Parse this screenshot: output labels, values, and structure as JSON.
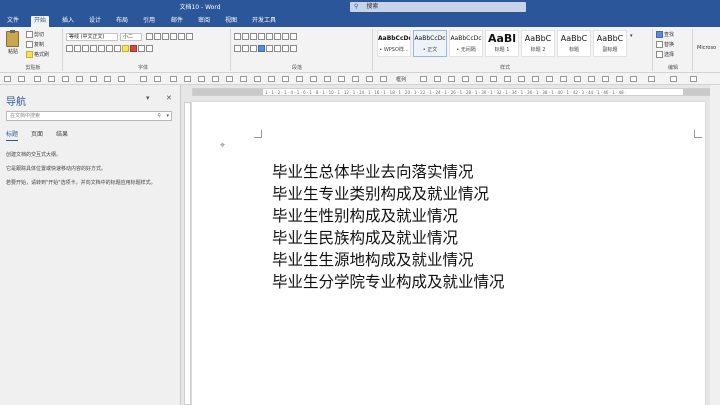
{
  "window": {
    "title": "文档10 - Word"
  },
  "search": {
    "placeholder": "搜索"
  },
  "tabs": [
    {
      "label": "文件"
    },
    {
      "label": "开始"
    },
    {
      "label": "插入"
    },
    {
      "label": "设计"
    },
    {
      "label": "布局"
    },
    {
      "label": "引用"
    },
    {
      "label": "邮件"
    },
    {
      "label": "审阅"
    },
    {
      "label": "视图"
    },
    {
      "label": "开发工具"
    }
  ],
  "ribbon": {
    "clipboard": {
      "paste": "粘贴",
      "cut": "剪切",
      "copy": "复制",
      "format_painter": "格式刷",
      "group": "剪贴板"
    },
    "font": {
      "name": "等线 (中文正文)",
      "size": "小二",
      "group": "字体"
    },
    "paragraph": {
      "group": "段落"
    },
    "styles": {
      "group": "样式",
      "items": [
        {
          "preview": "AaBbCcDd",
          "name": "• WPSO样..."
        },
        {
          "preview": "AaBbCcDc",
          "name": "• 正文"
        },
        {
          "preview": "AaBbCcDc",
          "name": "• 无间隔"
        },
        {
          "preview": "AaBl",
          "name": "标题 1"
        },
        {
          "preview": "AaBbC",
          "name": "标题 2"
        },
        {
          "preview": "AaBbC",
          "name": "标题"
        },
        {
          "preview": "AaBbC",
          "name": "副标题"
        }
      ]
    },
    "editing": {
      "find": "查找",
      "replace": "替换",
      "select": "选择",
      "group": "编辑"
    },
    "extra": "Microso"
  },
  "qat": {
    "rows_label": "框列"
  },
  "nav": {
    "title": "导航",
    "search_placeholder": "在文档中搜索",
    "tabs": [
      {
        "label": "标题"
      },
      {
        "label": "页面"
      },
      {
        "label": "结果"
      }
    ],
    "text1": "创建文档的交互式大纲。",
    "text2": "它是跟踪具体位置或快速移动内容的好方式。",
    "text3": "若要开始，请转到\"开始\"选项卡，并向文档中的标题应用标题样式。"
  },
  "ruler": {
    "ticks": "1 · 1 · 2 · 1 · 4 · 1 · 6 · 1 · 8 · 1 · 10 · 1 · 12 · 1 · 14 · 1 · 16 · 1 · 18 · 1 · 20 · 1 · 22 · 1 · 24 · 1 · 26 · 1 · 28 · 1 · 30 · 1 · 32 · 1 · 34 · 1 · 36 · 1 · 38 · 1 · 40 · 1 · 42 · 1 · 44 · 1 · 46 · 1 · 48 ·"
  },
  "document": {
    "lines": [
      "毕业生总体毕业去向落实情况",
      "毕业生专业类别构成及就业情况",
      "毕业生性别构成及就业情况",
      "毕业生民族构成及就业情况",
      "毕业生生源地构成及就业情况",
      "毕业生分学院专业构成及就业情况"
    ]
  },
  "colors": {
    "brand": "#2b579a",
    "ribbon_bg": "#f3f3f3",
    "canvas": "#e6e6e6"
  }
}
